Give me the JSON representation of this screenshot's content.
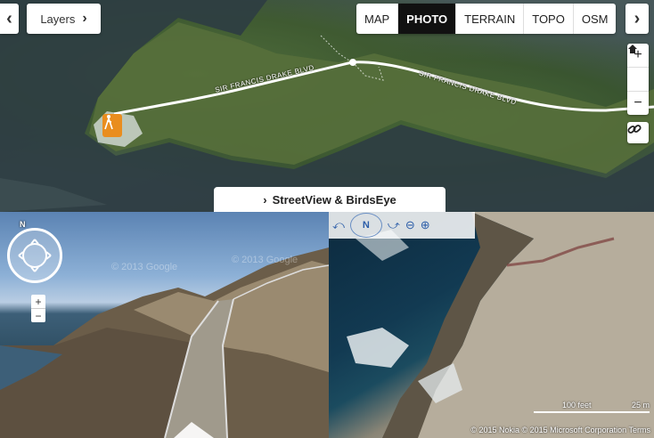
{
  "map": {
    "layers_label": "Layers",
    "tabs": [
      {
        "label": "MAP",
        "active": false
      },
      {
        "label": "PHOTO",
        "active": true
      },
      {
        "label": "TERRAIN",
        "active": false
      },
      {
        "label": "TOPO",
        "active": false
      },
      {
        "label": "OSM",
        "active": false
      }
    ],
    "road_label_1": "SIR FRANCIS DRAKE BLVD",
    "road_label_2": "SIR FRANCIS DRAKE BLVD",
    "zoom_in": "+",
    "zoom_out": "−",
    "left_arrow": "‹",
    "right_arrow": "›"
  },
  "streetview_bar": {
    "label": "StreetView & BirdsEye"
  },
  "streetview": {
    "watermark_1": "© 2013 Google",
    "watermark_2": "© 2013 Google",
    "compass_letter": "N",
    "zoom_in": "+",
    "zoom_out": "−"
  },
  "birdseye": {
    "compass_letter": "N",
    "scale_feet": "100 feet",
    "scale_m": "25 m",
    "copyright": "© 2015 Nokia  © 2015 Microsoft Corporation  Terms"
  }
}
